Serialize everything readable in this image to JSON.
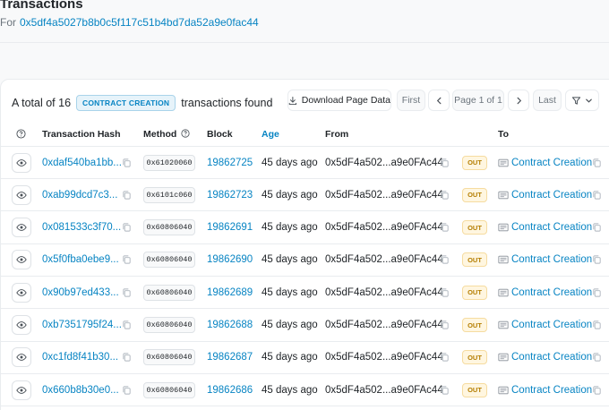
{
  "header": {
    "title": "Transactions",
    "for_label": "For",
    "address": "0x5df4a5027b8b0c5f117c51b4bd7da52a9e0fac44"
  },
  "summary": {
    "prefix": "A total of 16",
    "badge": "CONTRACT CREATION",
    "suffix": "transactions found"
  },
  "toolbar": {
    "download_label": "Download Page Data",
    "first_label": "First",
    "page_label": "Page 1 of 1",
    "last_label": "Last"
  },
  "columns": {
    "hash": "Transaction Hash",
    "method": "Method",
    "block": "Block",
    "age": "Age",
    "from": "From",
    "to": "To"
  },
  "rows": [
    {
      "hash": "0xdaf540ba1bb...",
      "method": "0x61020060",
      "block": "19862725",
      "age": "45 days ago",
      "from": "0x5dF4a502...a9e0FAc44",
      "direction": "OUT",
      "to": "Contract Creation"
    },
    {
      "hash": "0xab99dcd7c3...",
      "method": "0x6101c060",
      "block": "19862723",
      "age": "45 days ago",
      "from": "0x5dF4a502...a9e0FAc44",
      "direction": "OUT",
      "to": "Contract Creation"
    },
    {
      "hash": "0x081533c3f70...",
      "method": "0x60806040",
      "block": "19862691",
      "age": "45 days ago",
      "from": "0x5dF4a502...a9e0FAc44",
      "direction": "OUT",
      "to": "Contract Creation"
    },
    {
      "hash": "0x5f0fba0ebe9...",
      "method": "0x60806040",
      "block": "19862690",
      "age": "45 days ago",
      "from": "0x5dF4a502...a9e0FAc44",
      "direction": "OUT",
      "to": "Contract Creation"
    },
    {
      "hash": "0x90b97ed433...",
      "method": "0x60806040",
      "block": "19862689",
      "age": "45 days ago",
      "from": "0x5dF4a502...a9e0FAc44",
      "direction": "OUT",
      "to": "Contract Creation"
    },
    {
      "hash": "0xb7351795f24...",
      "method": "0x60806040",
      "block": "19862688",
      "age": "45 days ago",
      "from": "0x5dF4a502...a9e0FAc44",
      "direction": "OUT",
      "to": "Contract Creation"
    },
    {
      "hash": "0xc1fd8f41b30...",
      "method": "0x60806040",
      "block": "19862687",
      "age": "45 days ago",
      "from": "0x5dF4a502...a9e0FAc44",
      "direction": "OUT",
      "to": "Contract Creation"
    },
    {
      "hash": "0x660b8b30e0...",
      "method": "0x60806040",
      "block": "19862686",
      "age": "45 days ago",
      "from": "0x5dF4a502...a9e0FAc44",
      "direction": "OUT",
      "to": "Contract Creation"
    }
  ],
  "colors": {
    "link": "#0784c3",
    "out_bg": "#fff6e0",
    "out_text": "#b47d00"
  }
}
